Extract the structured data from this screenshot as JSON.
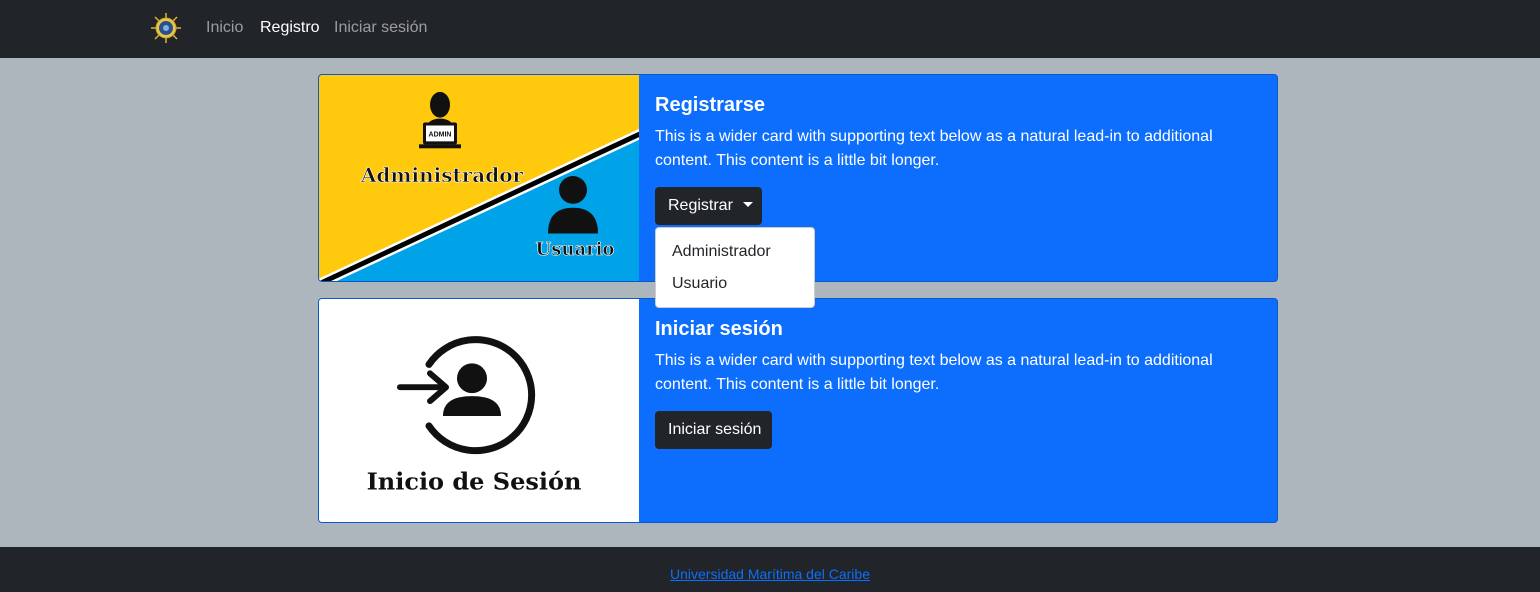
{
  "navbar": {
    "links": [
      {
        "label": "Inicio",
        "active": false
      },
      {
        "label": "Registro",
        "active": true
      },
      {
        "label": "Iniciar sesión",
        "active": false
      }
    ]
  },
  "register_card": {
    "image_labels": {
      "admin": "Administrador",
      "admin_badge": "ADMIN",
      "user": "Usuario"
    },
    "title": "Registrarse",
    "text": "This is a wider card with supporting text below as a natural lead-in to additional content. This content is a little bit longer.",
    "button_label": "Registrar",
    "dropdown_items": [
      "Administrador",
      "Usuario"
    ]
  },
  "login_card": {
    "image_label": "Inicio de Sesión",
    "title": "Iniciar sesión",
    "text": "This is a wider card with supporting text below as a natural lead-in to additional content. This content is a little bit longer.",
    "button_label": "Iniciar sesión"
  },
  "footer": {
    "link_text": "Universidad Marítima del Caribe"
  },
  "colors": {
    "navbar_bg": "#212529",
    "page_bg": "#adb5bd",
    "card_bg": "#0d6efd",
    "image_yellow": "#ffc90e",
    "image_blue": "#00a2e8"
  },
  "icons": [
    "compass-logo-icon",
    "admin-user-icon",
    "user-icon",
    "login-arrow-user-icon",
    "caret-down-icon"
  ]
}
